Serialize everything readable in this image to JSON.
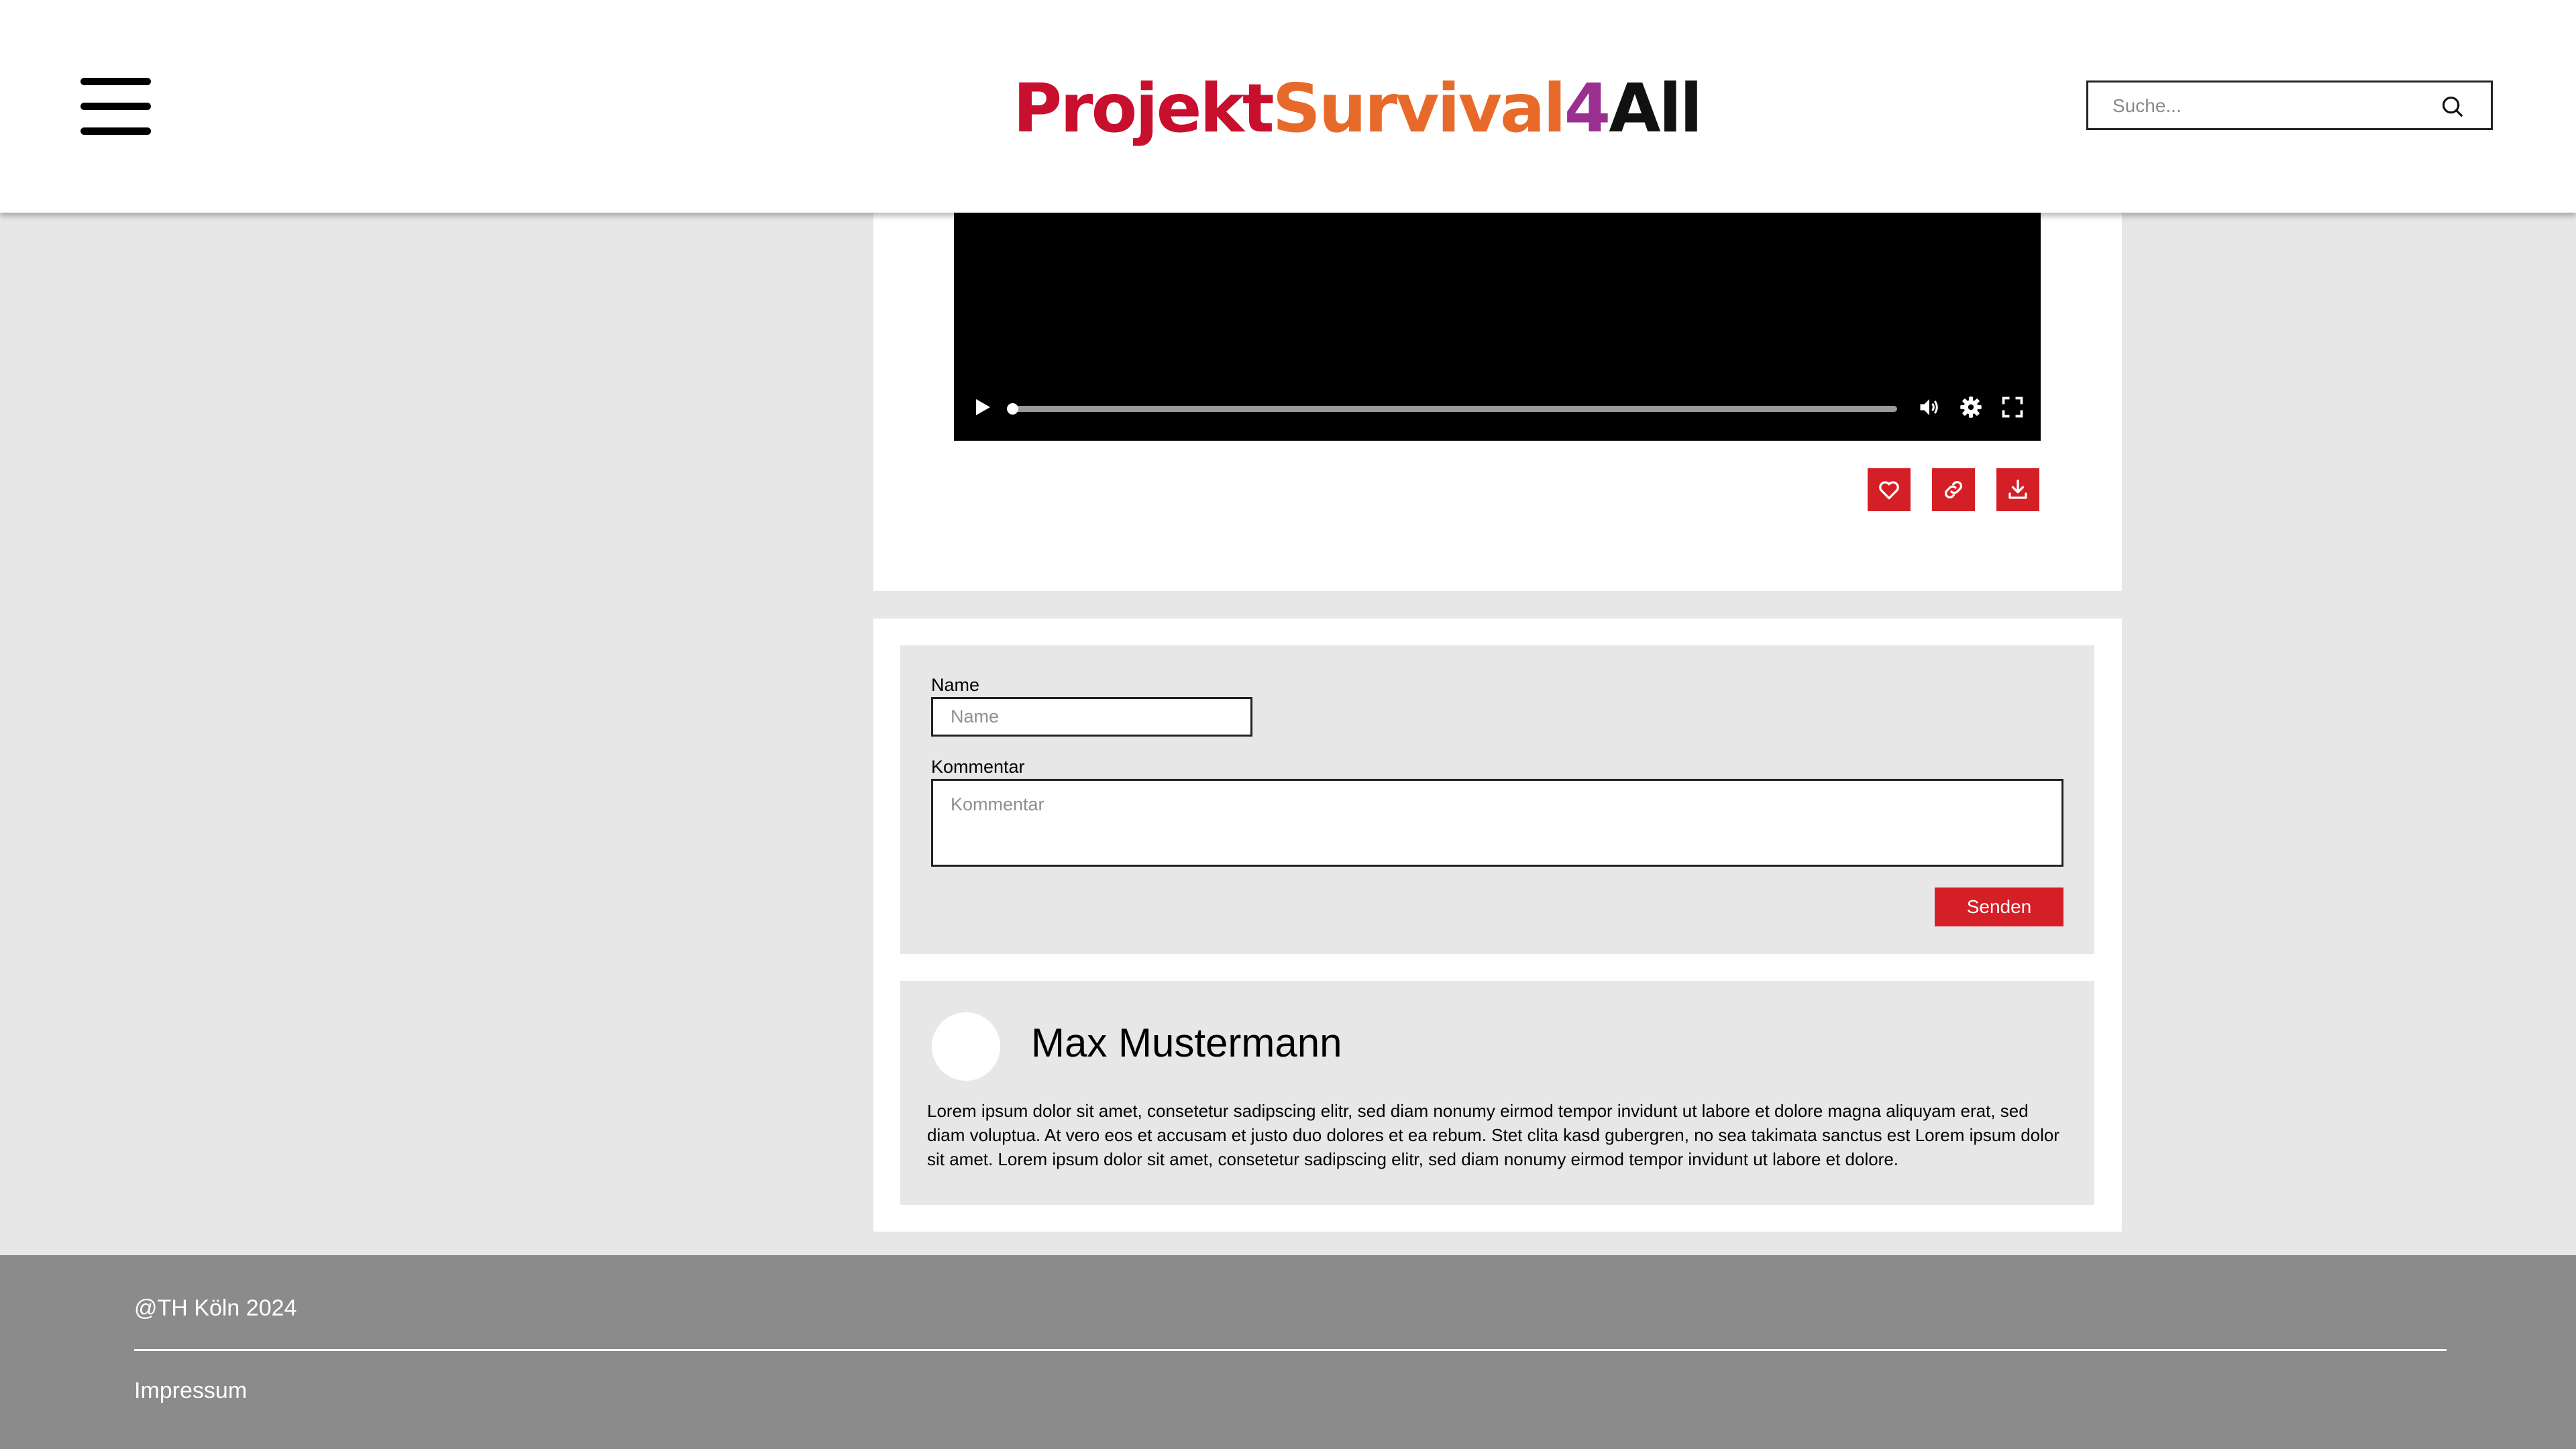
{
  "header": {
    "logo": {
      "parts": [
        {
          "text": "Projekt",
          "color": "#c8102e"
        },
        {
          "text": "Survival",
          "color": "#e86a2a"
        },
        {
          "text": "4",
          "color": "#9b2f8f"
        },
        {
          "text": "All",
          "color": "#111111"
        }
      ]
    },
    "search": {
      "placeholder": "Suche..."
    }
  },
  "video_player": {
    "progress": 0.005,
    "controls": [
      "play-icon",
      "volume-icon",
      "settings-gear-icon",
      "fullscreen-icon"
    ]
  },
  "actions": [
    "heart-icon",
    "link-icon",
    "download-icon"
  ],
  "comment_form": {
    "name_label": "Name",
    "name_placeholder": "Name",
    "comment_label": "Kommentar",
    "comment_placeholder": "Kommentar",
    "submit_label": "Senden"
  },
  "comments": [
    {
      "author": "Max Mustermann",
      "text": "Lorem ipsum dolor sit amet, consetetur sadipscing elitr, sed diam nonumy eirmod tempor invidunt ut labore et dolore magna aliquyam erat, sed diam voluptua. At vero eos et accusam et justo duo dolores et ea rebum. Stet clita kasd gubergren, no sea takimata sanctus est Lorem ipsum dolor sit amet. Lorem ipsum dolor sit amet, consetetur sadipscing elitr, sed diam nonumy eirmod tempor invidunt ut labore et dolore."
    }
  ],
  "footer": {
    "copyright": "@TH Köln 2024",
    "impressum": "Impressum"
  },
  "colors": {
    "accent": "#d51f26",
    "background": "#e7e7e7",
    "footer": "#8b8b8b"
  }
}
